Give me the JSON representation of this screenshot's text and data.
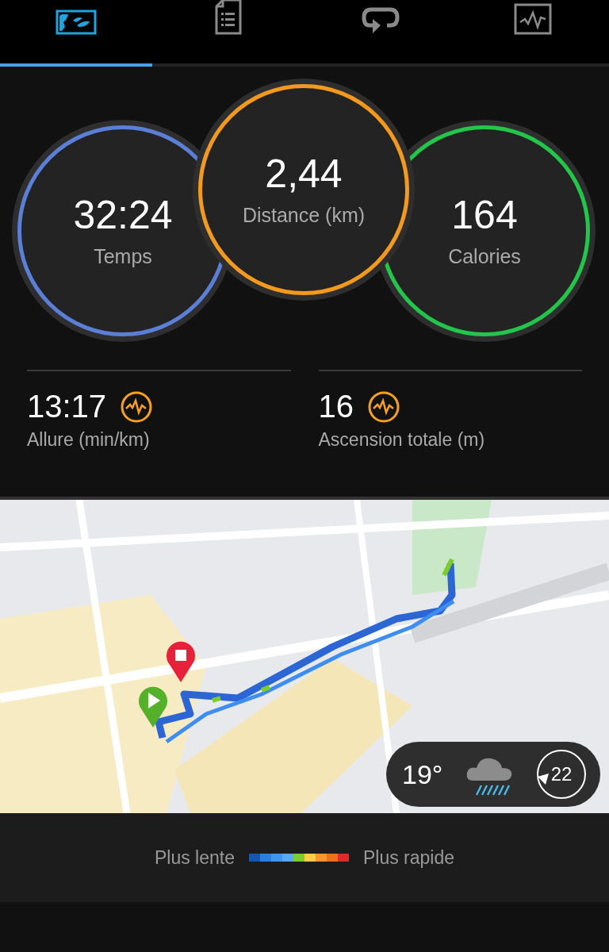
{
  "tabs": [
    {
      "selected": true
    },
    {
      "selected": false
    },
    {
      "selected": false
    },
    {
      "selected": false
    }
  ],
  "main_stats": [
    {
      "value": "32:24",
      "label": "Temps",
      "color": "#5b7fd6"
    },
    {
      "value": "2,44",
      "label": "Distance (km)",
      "color": "#f39a1e"
    },
    {
      "value": "164",
      "label": "Calories",
      "color": "#22c64a"
    }
  ],
  "detail_stats": [
    {
      "value": "13:17",
      "label": "Allure (min/km)"
    },
    {
      "value": "16",
      "label": "Ascension totale (m)"
    }
  ],
  "map": {
    "kind": "picture",
    "weather": {
      "temperature": "19°",
      "wind_speed": "22"
    }
  },
  "legend": {
    "slow_label": "Plus lente",
    "fast_label": "Plus rapide",
    "scale": [
      {
        "color": "#1556b0"
      },
      {
        "color": "#2a7ee0"
      },
      {
        "color": "#3f96f0"
      },
      {
        "color": "#58aaf8"
      },
      {
        "color": "#7ccc2a"
      },
      {
        "color": "#ffcc4a"
      },
      {
        "color": "#f8962e"
      },
      {
        "color": "#ec6f1a"
      },
      {
        "color": "#dc2a28"
      }
    ]
  }
}
